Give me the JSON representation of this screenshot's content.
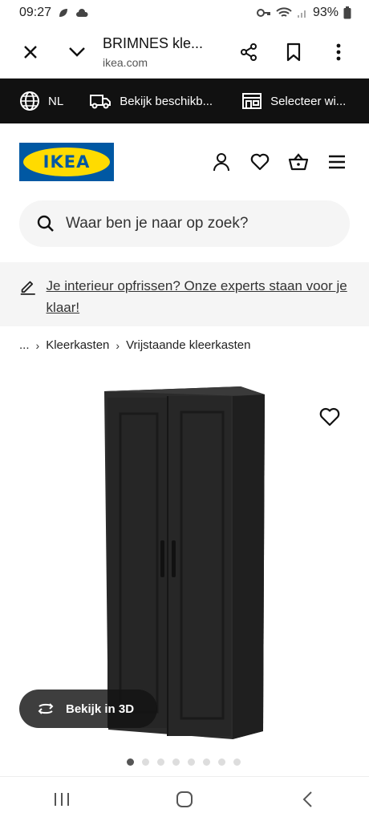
{
  "status_bar": {
    "time": "09:27",
    "battery": "93%"
  },
  "browser": {
    "title": "BRIMNES kle...",
    "url": "ikea.com"
  },
  "info_bar": {
    "language": "NL",
    "availability": "Bekijk beschikb...",
    "store": "Selecteer wi..."
  },
  "header": {
    "logo_text": "IKEA"
  },
  "search": {
    "placeholder": "Waar ben je naar op zoek?"
  },
  "promo": {
    "text": "Je interieur opfrissen? Onze experts staan voor je klaar!"
  },
  "breadcrumb": {
    "ellipsis": "...",
    "items": [
      "Kleerkasten",
      "Vrijstaande kleerkasten"
    ]
  },
  "product": {
    "view3d_label": "Bekijk in 3D",
    "image_count": 8,
    "active_image": 1
  }
}
